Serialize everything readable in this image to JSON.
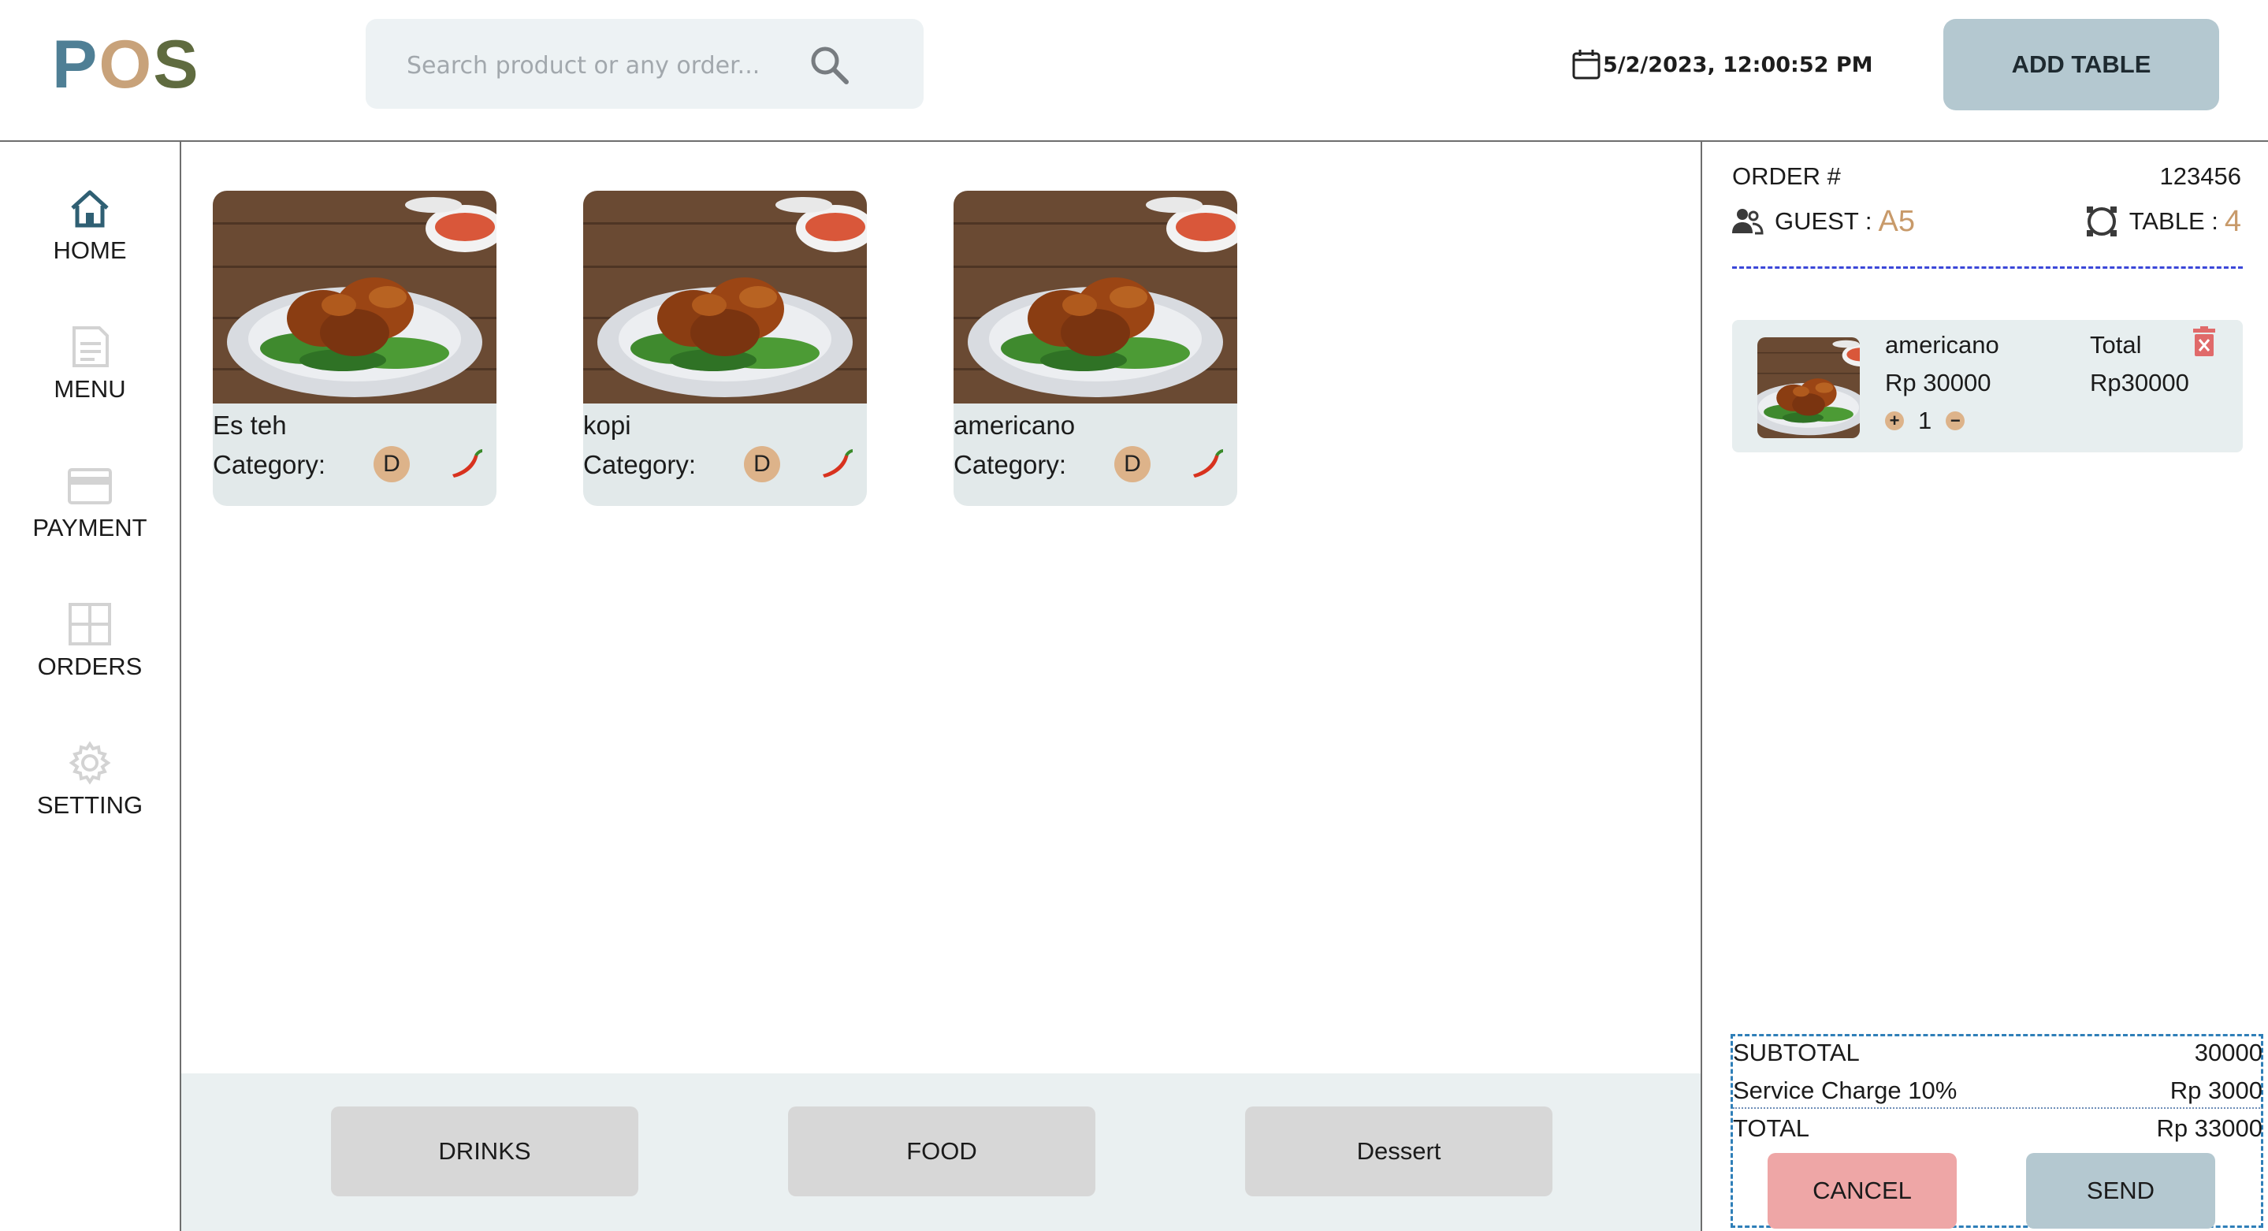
{
  "app": {
    "logo": [
      "P",
      "O",
      "S"
    ],
    "colors": {
      "logo_p": "#4f7f95",
      "logo_o": "#c8a27a",
      "logo_s": "#5f6b3f",
      "accent": "#c89a6a",
      "button": "#b4c8d0",
      "cancel": "#eea6a6",
      "badge": "#ddb38a"
    }
  },
  "header": {
    "search_placeholder": "Search product or any order...",
    "search_icon": "search-icon",
    "datetime": "5/2/2023,  12:00:52 PM",
    "datetime_icon": "calendar-icon",
    "add_table_label": "ADD TABLE"
  },
  "sidebar": {
    "items": [
      {
        "label": "HOME",
        "icon": "home-icon"
      },
      {
        "label": "MENU",
        "icon": "menu-icon"
      },
      {
        "label": "PAYMENT",
        "icon": "credit-card-icon"
      },
      {
        "label": "ORDERS",
        "icon": "orders-grid-icon"
      },
      {
        "label": "SETTING",
        "icon": "gear-icon"
      }
    ]
  },
  "products": [
    {
      "name": "Es teh",
      "category_label": "Category:",
      "badge": "D",
      "icon": "chili-icon"
    },
    {
      "name": "kopi",
      "category_label": "Category:",
      "badge": "D",
      "icon": "chili-icon"
    },
    {
      "name": "americano",
      "category_label": "Category:",
      "badge": "D",
      "icon": "chili-icon"
    }
  ],
  "categories": [
    "DRINKS",
    "FOOD",
    "Dessert"
  ],
  "order": {
    "order_label": "ORDER #",
    "order_number": "123456",
    "guest_label": "GUEST :",
    "guest_value": "A5",
    "table_label": "TABLE :",
    "table_value": "4",
    "items": [
      {
        "name": "americano",
        "price": "Rp 30000",
        "qty": "1",
        "total_label": "Total",
        "total_value": "Rp30000",
        "plus": "+",
        "minus": "−"
      }
    ],
    "summary": {
      "subtotal_label": "SUBTOTAL",
      "subtotal_value": "30000",
      "service_label": "Service Charge 10%",
      "service_value": "Rp 3000",
      "total_label": "TOTAL",
      "total_value": "Rp 33000"
    },
    "cancel_label": "CANCEL",
    "send_label": "SEND"
  }
}
